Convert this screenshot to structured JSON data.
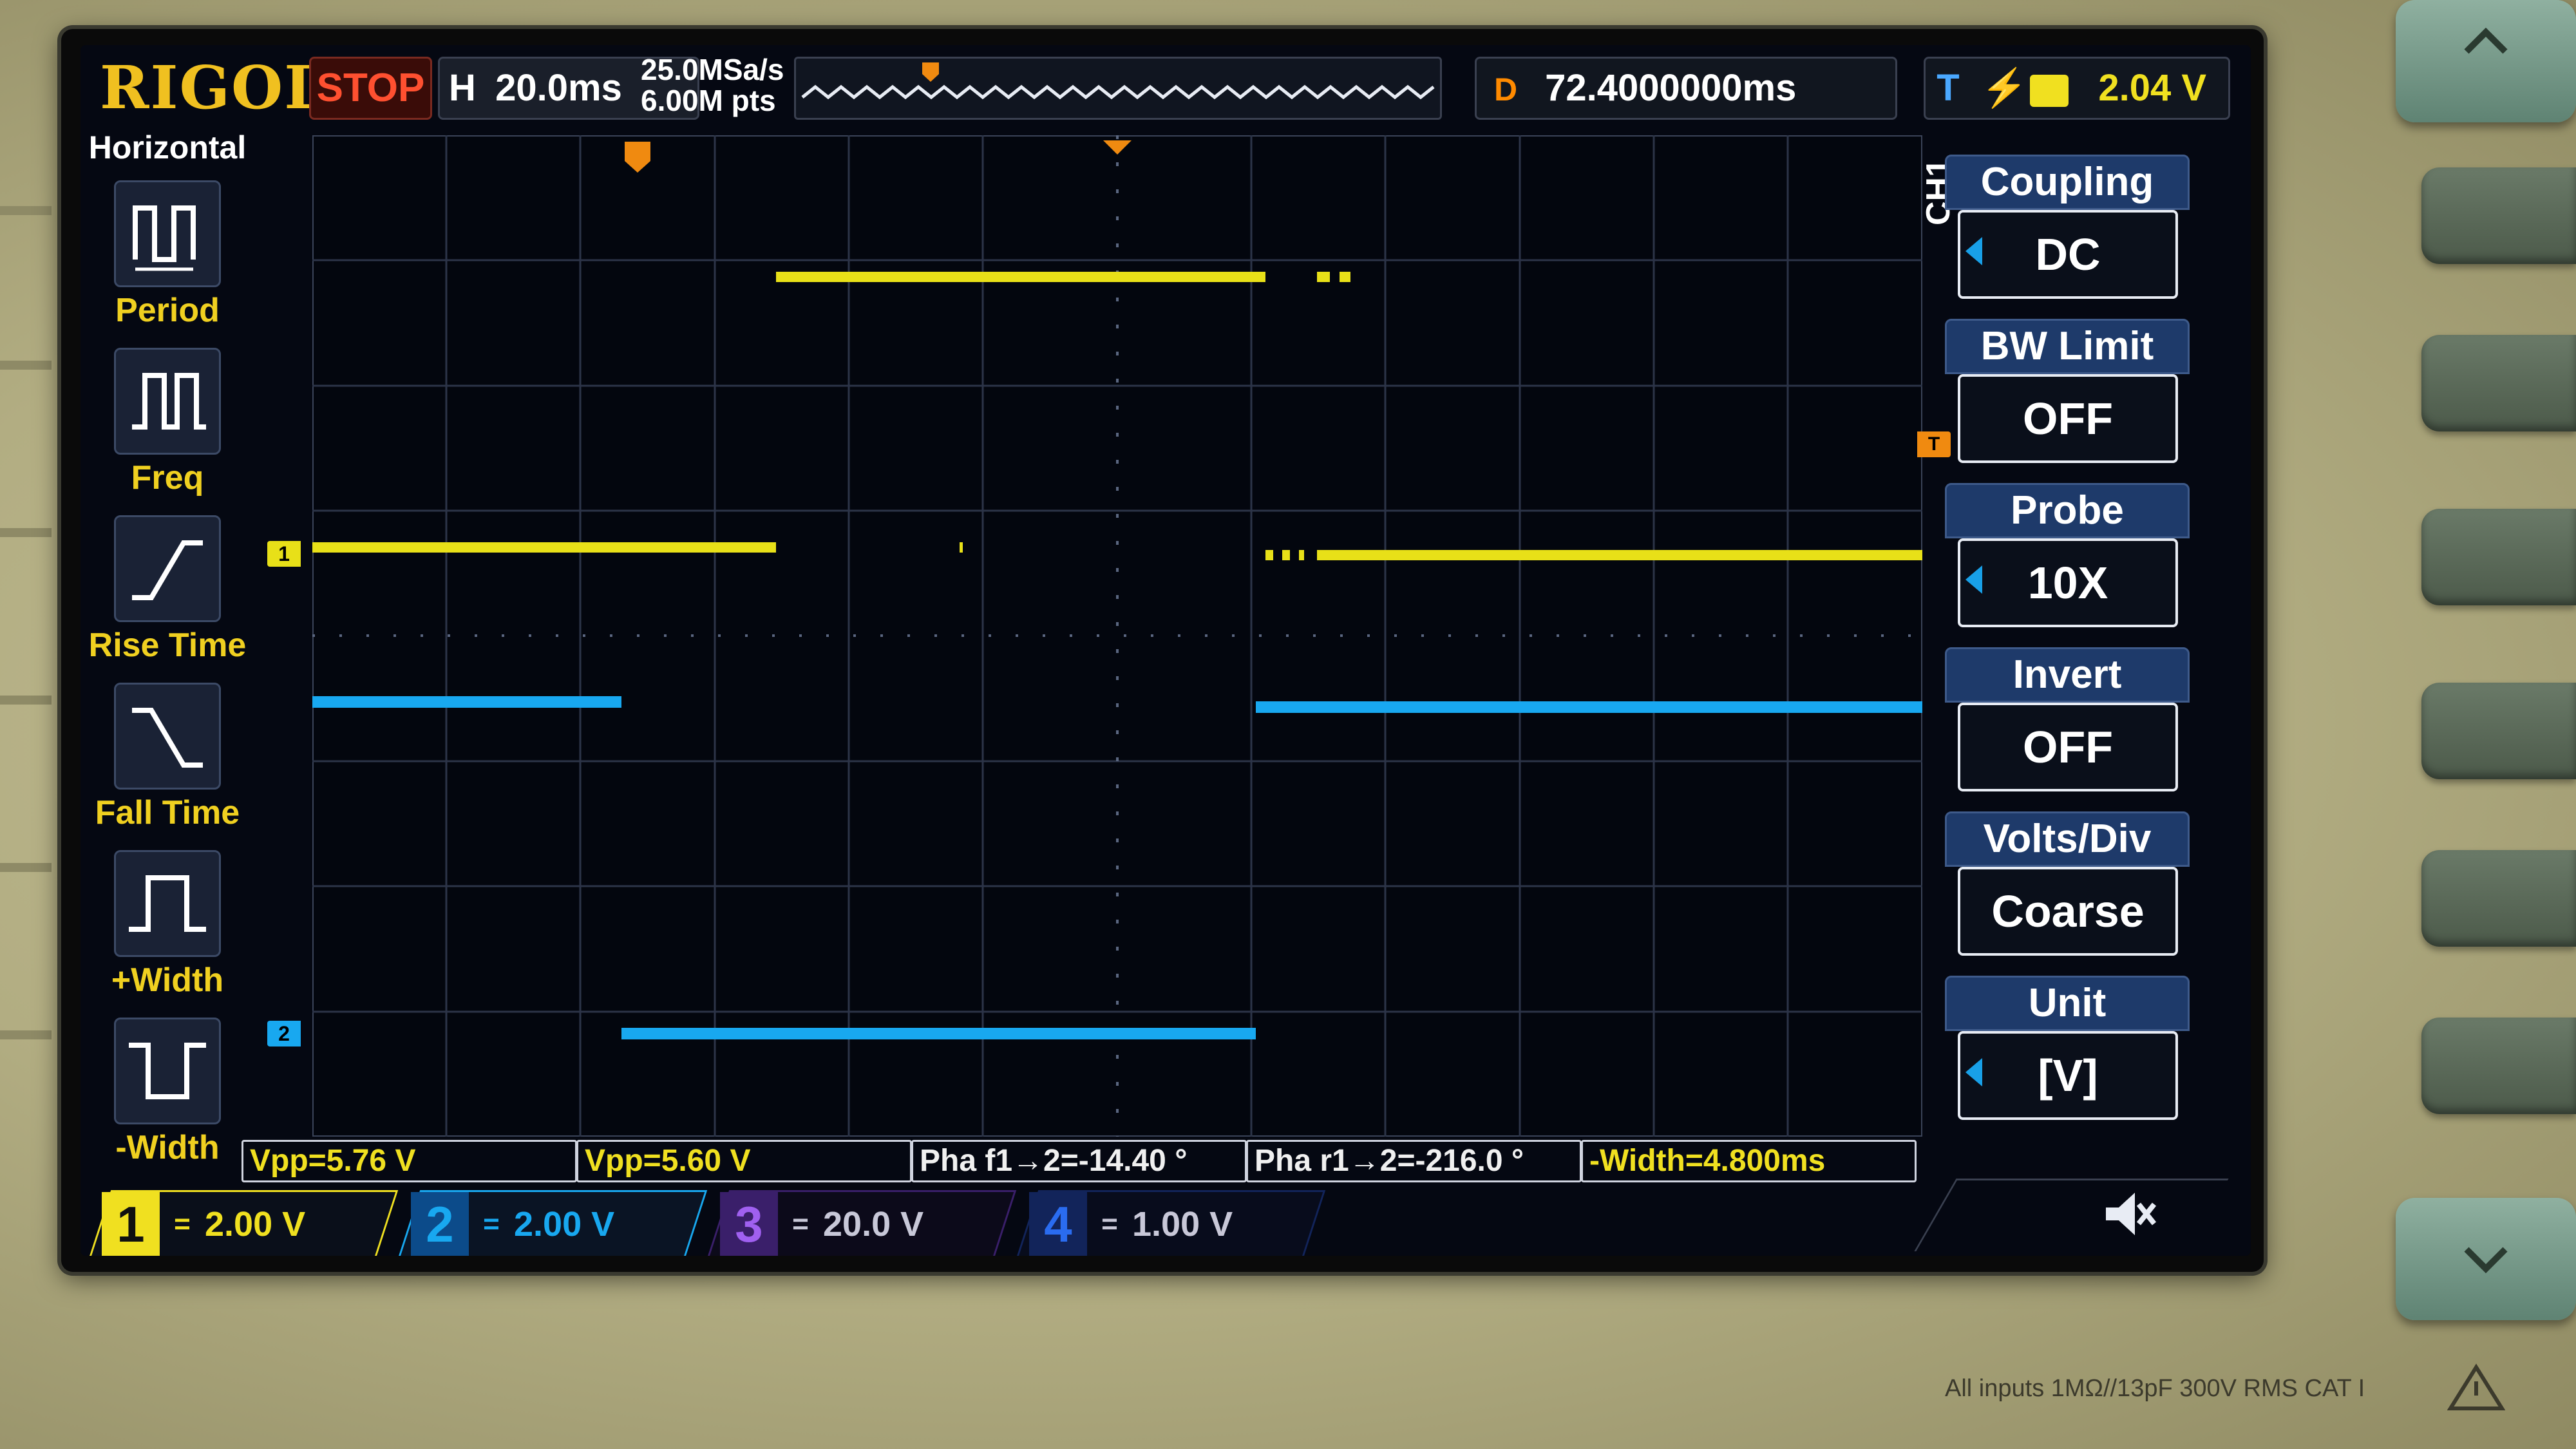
{
  "brand": "RIGOL",
  "run_status": "STOP",
  "horizontal": {
    "label": "H",
    "timebase": "20.0ms"
  },
  "acquisition": {
    "sample_rate": "25.0MSa/s",
    "memory_depth": "6.00M pts"
  },
  "delay": {
    "label": "D",
    "value": "72.4000000ms"
  },
  "trigger": {
    "label": "T",
    "level": "2.04 V"
  },
  "left_menu": {
    "title": "Horizontal",
    "items": [
      {
        "label": "Period",
        "icon": "period-icon"
      },
      {
        "label": "Freq",
        "icon": "freq-icon"
      },
      {
        "label": "Rise Time",
        "icon": "rise-time-icon"
      },
      {
        "label": "Fall Time",
        "icon": "fall-time-icon"
      },
      {
        "label": "+Width",
        "icon": "positive-width-icon"
      },
      {
        "label": "-Width",
        "icon": "negative-width-icon"
      }
    ]
  },
  "right_menu": {
    "channel_tag": "CH1",
    "items": [
      {
        "header": "Coupling",
        "value": "DC",
        "has_arrow": true
      },
      {
        "header": "BW Limit",
        "value": "OFF",
        "has_arrow": false
      },
      {
        "header": "Probe",
        "value": "10X",
        "has_arrow": true
      },
      {
        "header": "Invert",
        "value": "OFF",
        "has_arrow": false
      },
      {
        "header": "Volts/Div",
        "value": "Coarse",
        "has_arrow": false
      },
      {
        "header": "Unit",
        "value": "[V]",
        "has_arrow": true
      }
    ]
  },
  "measurements": [
    {
      "text": "Vpp=5.76 V",
      "color": "#f0e020"
    },
    {
      "text": "Vpp=5.60 V",
      "color": "#f0e020"
    },
    {
      "text": "Pha f1→2=-14.40 °",
      "color": "#f0f0f0"
    },
    {
      "text": "Pha r1→2=-216.0 °",
      "color": "#f0f0f0"
    },
    {
      "text": "-Width=4.800ms",
      "color": "#f0e020"
    }
  ],
  "channels": [
    {
      "num": "1",
      "coupling": "=",
      "scale": "2.00 V",
      "color": "#f0e020",
      "bg": "#f0e020",
      "text": "#101010"
    },
    {
      "num": "2",
      "coupling": "=",
      "scale": "2.00 V",
      "color": "#18a8f0",
      "bg": "#0c4b8a",
      "text": "#ffffff"
    },
    {
      "num": "3",
      "coupling": "=",
      "scale": "20.0 V",
      "color": "#a060f0",
      "bg": "#3a1f6a",
      "text": "#ffffff"
    },
    {
      "num": "4",
      "coupling": "=",
      "scale": "1.00 V",
      "color": "#2a6cf0",
      "bg": "#12245a",
      "text": "#ffffff"
    }
  ],
  "markers": {
    "ch1": "1",
    "ch2": "2",
    "trigger": "T"
  },
  "footer": "All inputs 1MΩ//13pF 300V RMS  CAT I",
  "colors": {
    "ch1": "#f0e020",
    "ch2": "#18a8f0",
    "grid": "#3a4358",
    "accent": "#f0c020"
  }
}
